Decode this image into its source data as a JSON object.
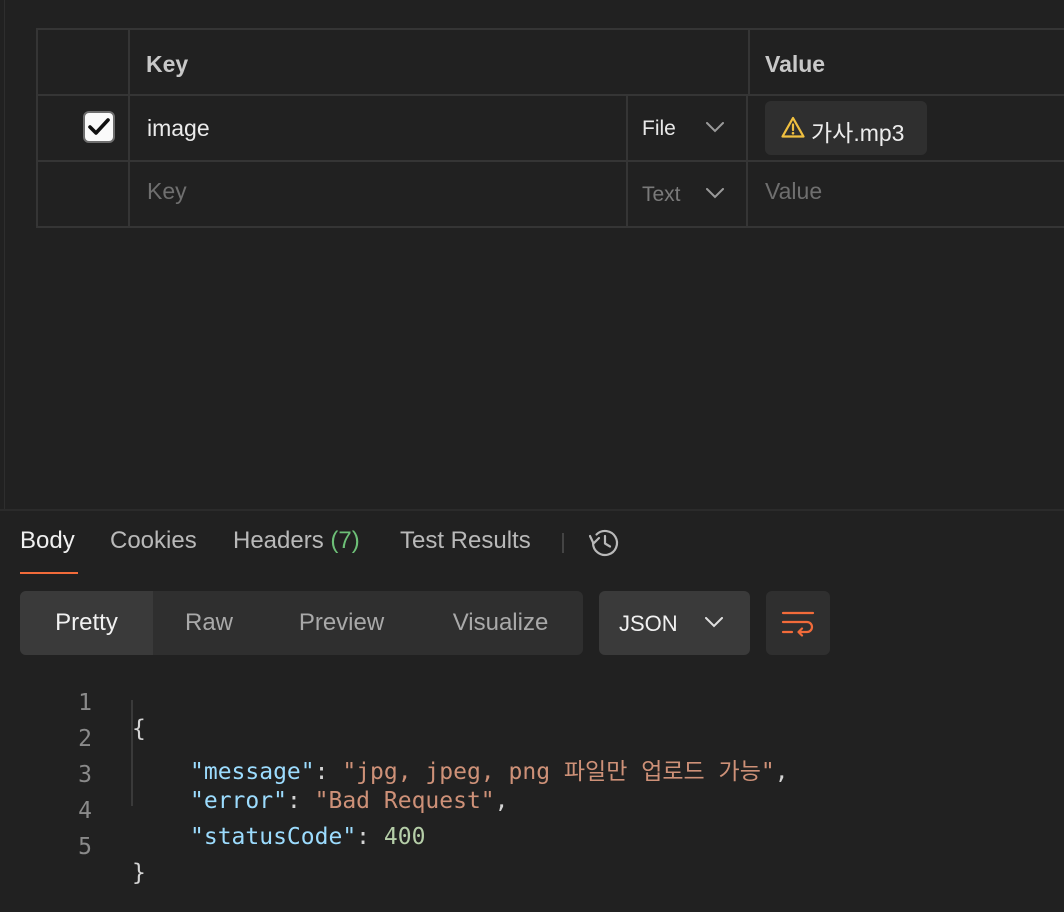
{
  "table": {
    "header_key": "Key",
    "header_value": "Value",
    "rows": [
      {
        "checked": true,
        "key": "image",
        "type": "File",
        "file_name": "가사.mp3",
        "file_status_icon": "warning-icon"
      }
    ],
    "empty_row": {
      "key_placeholder": "Key",
      "type": "Text",
      "value_placeholder": "Value"
    }
  },
  "response": {
    "tabs": {
      "body": "Body",
      "cookies": "Cookies",
      "headers": "Headers",
      "headers_count": "(7)",
      "test_results": "Test Results"
    },
    "views": [
      "Pretty",
      "Raw",
      "Preview",
      "Visualize"
    ],
    "active_view": "Pretty",
    "format": "JSON",
    "code": {
      "lines": [
        "1",
        "2",
        "3",
        "4",
        "5"
      ],
      "open_brace": "{",
      "close_brace": "}",
      "message_key": "\"message\"",
      "message_value": "\"jpg, jpeg, png 파일만 업로드 가능\"",
      "error_key": "\"error\"",
      "error_value": "\"Bad Request\"",
      "status_key": "\"statusCode\"",
      "status_value": "400"
    }
  },
  "colors": {
    "background": "#212121",
    "accent": "#f26b3a",
    "headers_count": "#6dbf77",
    "json_key": "#9cdcfe",
    "json_string": "#ce9178",
    "json_number": "#b5cea8",
    "warning": "#f0c040"
  }
}
